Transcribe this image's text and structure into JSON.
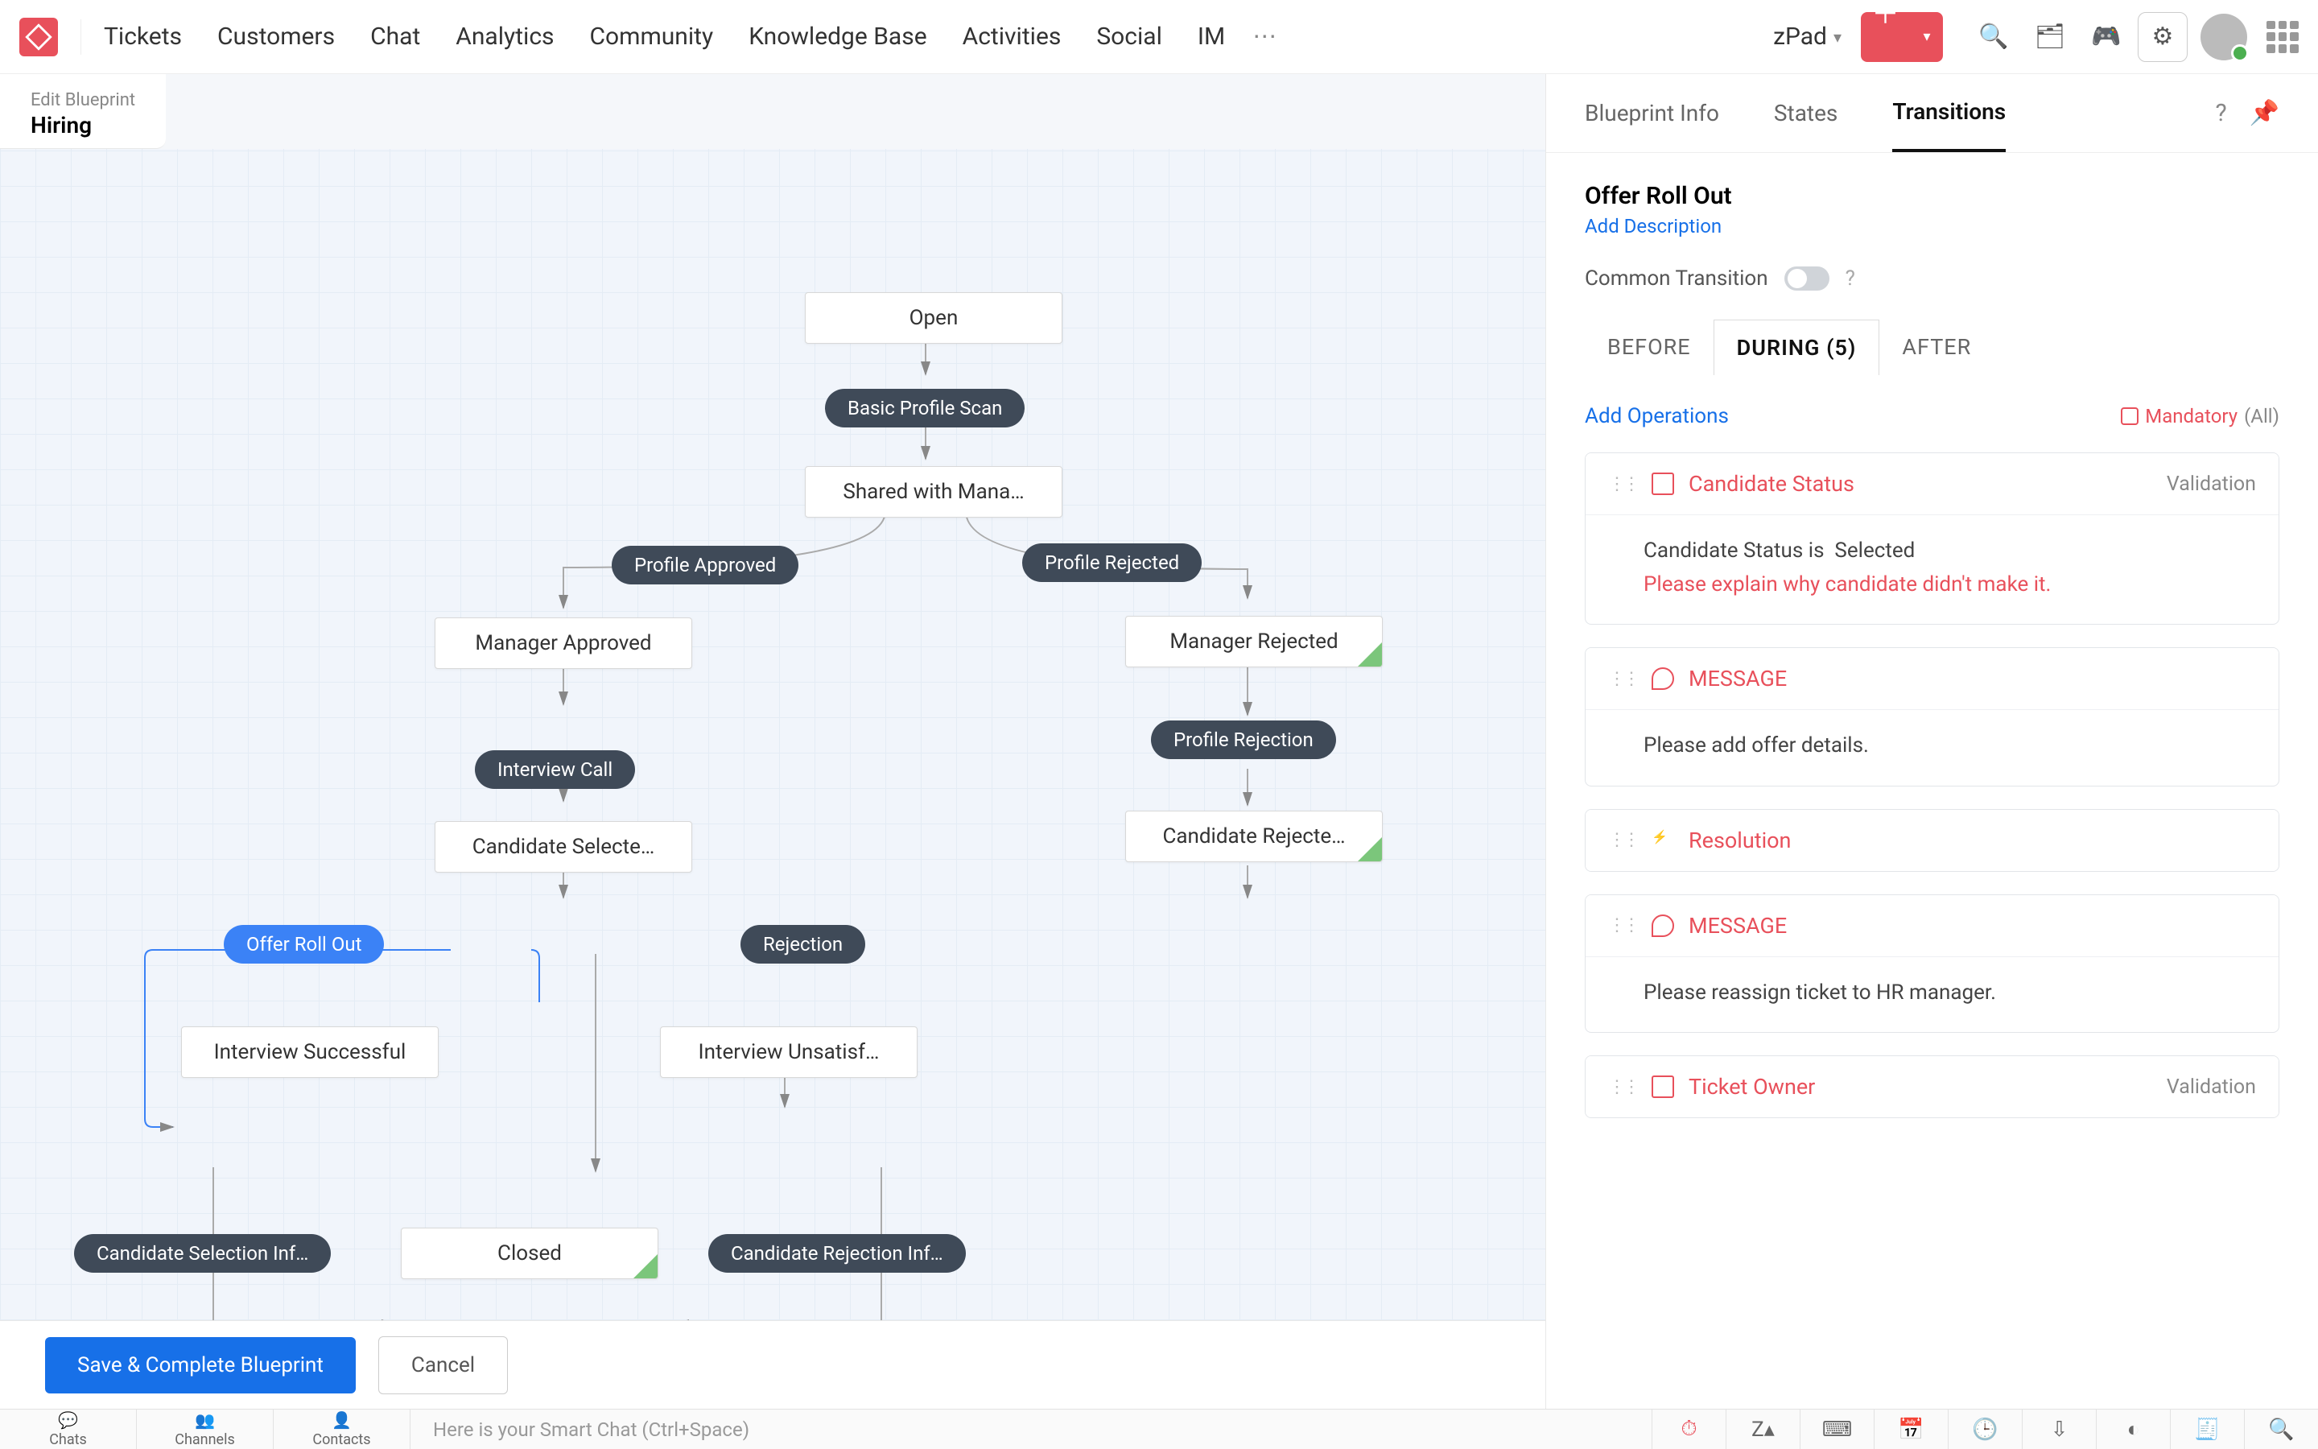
{
  "nav": {
    "items": [
      "Tickets",
      "Customers",
      "Chat",
      "Analytics",
      "Community",
      "Knowledge Base",
      "Activities",
      "Social",
      "IM"
    ],
    "workspace": "zPad"
  },
  "blueprint": {
    "edit_label": "Edit Blueprint",
    "name": "Hiring",
    "save_btn": "Save & Complete Blueprint",
    "cancel_btn": "Cancel"
  },
  "nodes": {
    "open": "Open",
    "basic_scan": "Basic Profile Scan",
    "shared_mgr": "Shared with Mana…",
    "profile_approved": "Profile Approved",
    "profile_rejected": "Profile Rejected",
    "mgr_approved": "Manager Approved",
    "mgr_rejected": "Manager Rejected",
    "interview_call": "Interview Call",
    "profile_rejection": "Profile Rejection",
    "cand_selected": "Candidate Selecte…",
    "cand_rejected": "Candidate Rejecte…",
    "offer_roll": "Offer Roll Out",
    "rejection": "Rejection",
    "int_success": "Interview Successful",
    "int_unsat": "Interview Unsatisf…",
    "cand_sel_info": "Candidate Selection Inf…",
    "cand_rej_info": "Candidate Rejection Inf…",
    "closed": "Closed"
  },
  "panel": {
    "tabs": {
      "info": "Blueprint Info",
      "states": "States",
      "transitions": "Transitions"
    },
    "trans_title": "Offer Roll Out",
    "add_desc": "Add Description",
    "common": "Common Transition",
    "subtabs": {
      "before": "BEFORE",
      "during": "DURING (5)",
      "after": "AFTER"
    },
    "add_ops": "Add Operations",
    "mandatory": "Mandatory",
    "mandatory_all": "(All)",
    "ops": [
      {
        "name": "Candidate Status",
        "type": "field",
        "validation": "Validation",
        "body_line1_a": "Candidate Status is",
        "body_line1_b": "Selected",
        "body_line2": "Please explain why candidate didn't make it."
      },
      {
        "name": "MESSAGE",
        "type": "msg",
        "body": "Please add offer details."
      },
      {
        "name": "Resolution",
        "type": "bolt"
      },
      {
        "name": "MESSAGE",
        "type": "msg",
        "body": "Please reassign ticket to HR manager."
      },
      {
        "name": "Ticket Owner",
        "type": "field",
        "validation": "Validation"
      }
    ]
  },
  "bottombar": {
    "tabs": [
      "Chats",
      "Channels",
      "Contacts"
    ],
    "smart": "Here is your Smart Chat (Ctrl+Space)"
  }
}
